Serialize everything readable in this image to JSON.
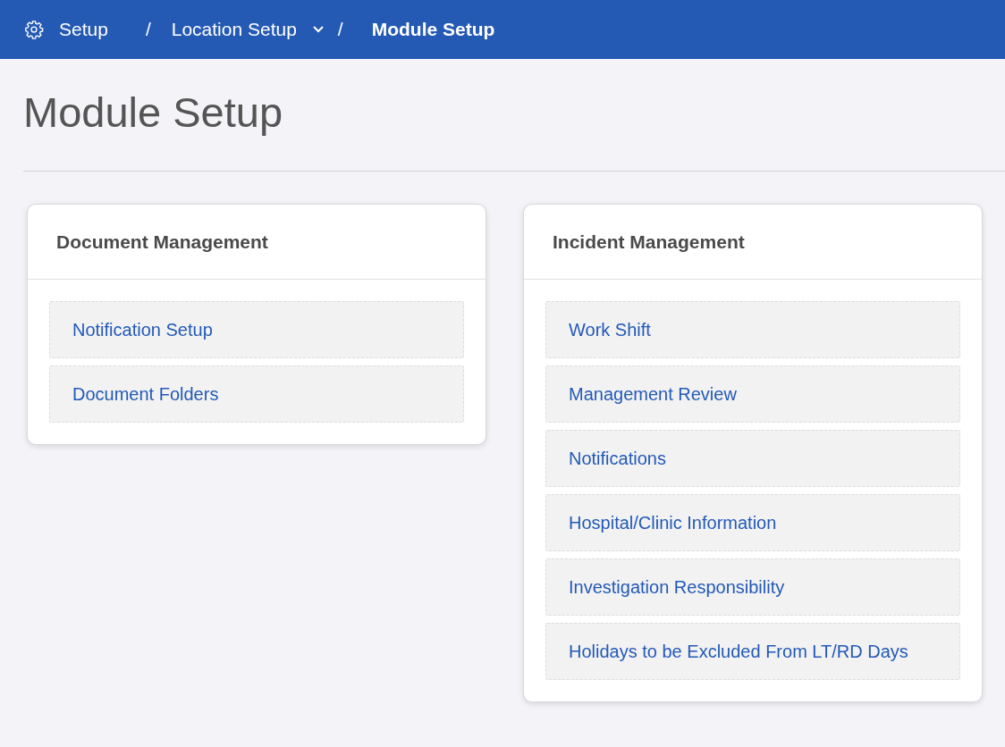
{
  "breadcrumbs": [
    {
      "kind": "home",
      "label": "Setup"
    },
    {
      "kind": "separator",
      "label": "/"
    },
    {
      "kind": "dropdown",
      "label": "Location Setup"
    },
    {
      "kind": "separator",
      "label": "/"
    },
    {
      "kind": "current",
      "label": "Module Setup"
    }
  ],
  "page_title": "Module Setup",
  "cards": [
    {
      "title": "Document Management",
      "links": [
        "Notification Setup",
        "Document Folders"
      ]
    },
    {
      "title": "Incident Management",
      "links": [
        "Work Shift",
        "Management Review",
        "Notifications",
        "Hospital/Clinic Information",
        "Investigation Responsibility",
        "Holidays to be Excluded From LT/RD Days"
      ]
    }
  ]
}
